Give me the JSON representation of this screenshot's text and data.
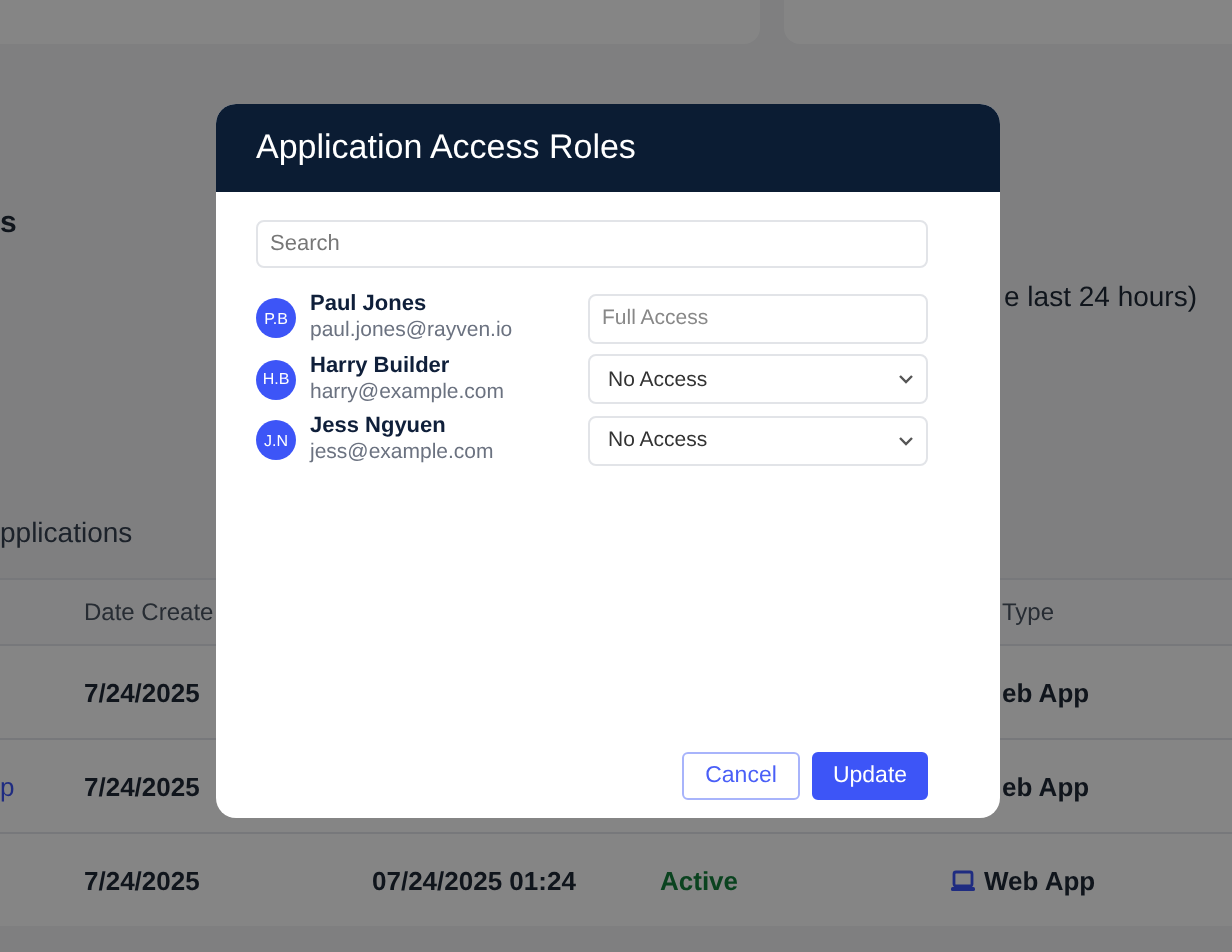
{
  "background": {
    "section_title": "s",
    "note": "e last 24 hours)",
    "table_title": "pplications",
    "table": {
      "columns": [
        "Date Create",
        "Type"
      ],
      "rows": [
        {
          "date": "7/24/2025",
          "type": "eb App"
        },
        {
          "name": "p",
          "date": "7/24/2025",
          "type": "eb App"
        },
        {
          "date": "7/24/2025",
          "column_3": "07/24/2025 01:24",
          "status": "Active",
          "type": "Web App",
          "icon": true
        }
      ]
    }
  },
  "dialog": {
    "title": "Application Access Roles",
    "search": {
      "placeholder": "Search"
    },
    "users": [
      {
        "initials": "P.B",
        "name": "Paul Jones",
        "email": "paul.jones@rayven.io",
        "role": "Full Access",
        "disabled": true
      },
      {
        "initials": "H.B",
        "name": "Harry Builder",
        "email": "harry@example.com",
        "role": "No Access",
        "disabled": false
      },
      {
        "initials": "J.N",
        "name": "Jess Ngyuen",
        "email": "jess@example.com",
        "role": "No Access",
        "disabled": false
      }
    ],
    "buttons": [
      {
        "label": "Cancel",
        "kind": "secondary"
      },
      {
        "label": "Update",
        "kind": "primary"
      }
    ]
  }
}
